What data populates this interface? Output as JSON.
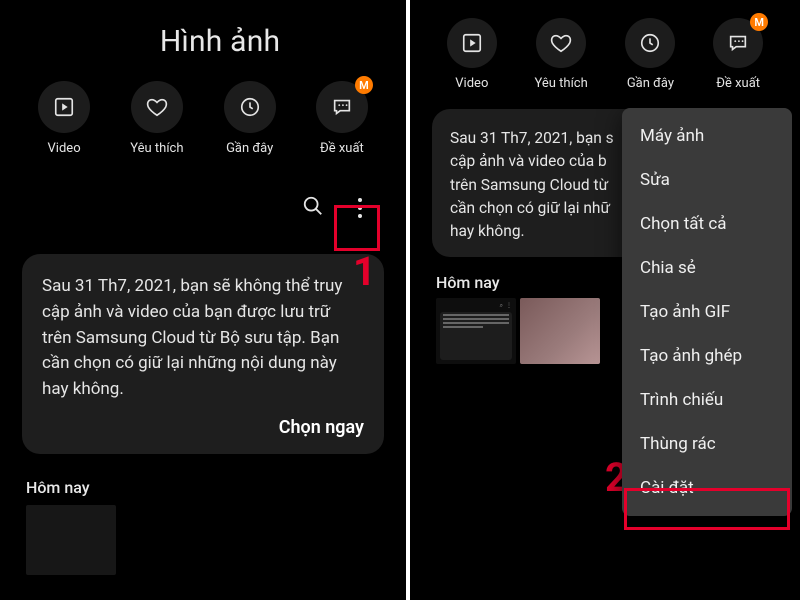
{
  "left": {
    "title": "Hình ảnh",
    "icons": [
      {
        "name": "video",
        "label": "Video"
      },
      {
        "name": "favorite",
        "label": "Yêu thích"
      },
      {
        "name": "recent",
        "label": "Gần đây"
      },
      {
        "name": "suggest",
        "label": "Đề xuất",
        "badge": "M"
      }
    ],
    "notice": "Sau 31 Th7, 2021, bạn sẽ không thể truy cập ảnh và video của bạn được lưu trữ trên Samsung Cloud từ Bộ sưu tập. Bạn cần chọn có giữ lại những nội dung này hay không.",
    "notice_cta": "Chọn ngay",
    "section": "Hôm nay",
    "step": "1"
  },
  "right": {
    "icons": [
      {
        "name": "video",
        "label": "Video"
      },
      {
        "name": "favorite",
        "label": "Yêu thích"
      },
      {
        "name": "recent",
        "label": "Gần đây"
      },
      {
        "name": "suggest",
        "label": "Đề xuất",
        "badge": "M"
      }
    ],
    "notice": "Sau 31 Th7, 2021, bạn s\ncập ảnh và video của b\ntrên Samsung Cloud từ\ncần chọn có giữ lại nhữ\nhay không.",
    "section": "Hôm nay",
    "menu": [
      "Máy ảnh",
      "Sửa",
      "Chọn tất cả",
      "Chia sẻ",
      "Tạo ảnh GIF",
      "Tạo ảnh ghép",
      "Trình chiếu",
      "Thùng rác",
      "Cài đặt"
    ],
    "step": "2"
  },
  "annotation": {
    "highlight_color": "#e4002b",
    "badge_color": "#ff7b00"
  }
}
